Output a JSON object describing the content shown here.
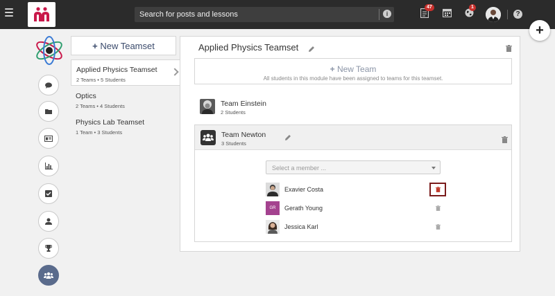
{
  "search": {
    "placeholder": "Search for posts and lessons"
  },
  "notifications": {
    "posts_count": "47",
    "updates_count": "1"
  },
  "new_teamset_label": "New Teamset",
  "teamsets": [
    {
      "name": "Applied Physics Teamset",
      "meta": "2 Teams • 5 Students",
      "active": true
    },
    {
      "name": "Optics",
      "meta": "2 Teams • 4 Students",
      "active": false
    },
    {
      "name": "Physics Lab Teamset",
      "meta": "1 Team • 3 Students",
      "active": false
    }
  ],
  "panel": {
    "title": "Applied Physics Teamset",
    "new_team_label": "New Team",
    "new_team_note": "All students in this module have been assigned to teams for this teamset."
  },
  "teams": [
    {
      "name": "Team Einstein",
      "meta": "2 Students"
    },
    {
      "name": "Team Newton",
      "meta": "3 Students"
    }
  ],
  "member_select": {
    "placeholder": "Select a member ..."
  },
  "members": [
    {
      "name": "Exavier Costa",
      "initials": ""
    },
    {
      "name": "Gerath Young",
      "initials": "GR"
    },
    {
      "name": "Jessica Karl",
      "initials": ""
    }
  ],
  "colors": {
    "accent": "#5a6b8c",
    "brand_red": "#c9184a",
    "badge": "#c9302c",
    "highlight": "#7a1a1a"
  }
}
